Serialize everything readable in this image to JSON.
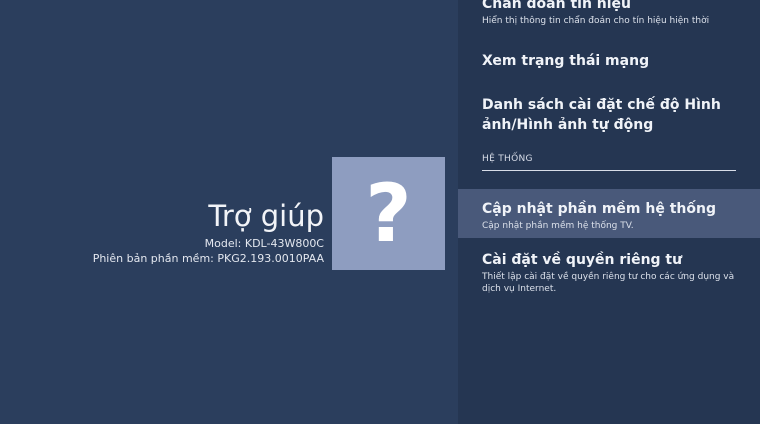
{
  "left": {
    "title": "Trợ giúp",
    "model": "Model: KDL-43W800C",
    "software": "Phiên bản phần mềm: PKG2.193.0010PAA",
    "help_symbol": "?"
  },
  "menu": {
    "signal": {
      "title": "Chẩn đoán tín hiệu",
      "desc": "Hiển thị thông tin chẩn đoán cho tín hiệu hiện thời"
    },
    "network": {
      "title": "Xem trạng thái mạng"
    },
    "picture_list": {
      "title": "Danh sách cài đặt chế độ Hình ảnh/Hình ảnh tự động"
    },
    "section": "HỆ THỐNG",
    "update": {
      "title": "Cập nhật phần mềm hệ thống",
      "desc": "Cập nhật phần mềm hệ thống TV."
    },
    "privacy": {
      "title": "Cài đặt về quyền riêng tư",
      "desc": "Thiết lập cài đặt về quyền riêng tư cho các ứng dụng và dịch vụ Internet."
    }
  }
}
